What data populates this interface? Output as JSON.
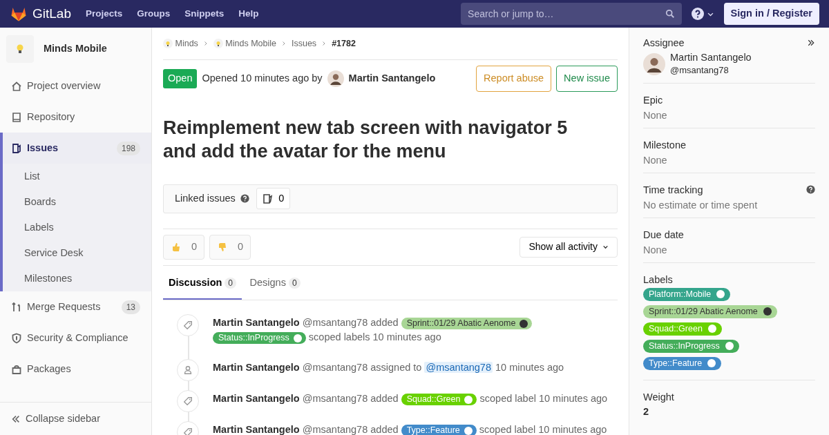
{
  "navbar": {
    "brand": "GitLab",
    "links": [
      "Projects",
      "Groups",
      "Snippets",
      "Help"
    ],
    "search": {
      "placeholder": "Search or jump to…"
    },
    "sign_in": "Sign in / Register"
  },
  "sidebar": {
    "project": "Minds Mobile",
    "items": [
      {
        "kind": "overview",
        "label": "Project overview",
        "selected": false
      },
      {
        "kind": "repository",
        "label": "Repository",
        "selected": false
      },
      {
        "kind": "issues",
        "label": "Issues",
        "count": "198",
        "selected": true,
        "children": [
          {
            "label": "List",
            "selected": false
          },
          {
            "label": "Boards",
            "selected": false
          },
          {
            "label": "Labels",
            "selected": false
          },
          {
            "label": "Service Desk",
            "selected": false
          },
          {
            "label": "Milestones",
            "selected": false
          }
        ]
      },
      {
        "kind": "merges",
        "label": "Merge Requests",
        "count": "13",
        "selected": false
      },
      {
        "kind": "security",
        "label": "Security & Compliance",
        "selected": false
      },
      {
        "kind": "packages",
        "label": "Packages",
        "selected": false
      }
    ],
    "collapse": "Collapse sidebar"
  },
  "breadcrumbs": [
    {
      "label": "Minds",
      "logo": true
    },
    {
      "label": "Minds Mobile",
      "logo": true
    },
    {
      "label": "Issues",
      "logo": false
    },
    {
      "label": "#1782",
      "logo": false
    }
  ],
  "issue": {
    "status": "Open",
    "opened": "Opened 10 minutes ago by",
    "author": "Martin Santangelo",
    "actions": [
      {
        "label": "Report abuse",
        "kind": "warning"
      },
      {
        "label": "New issue",
        "kind": "success"
      }
    ],
    "title": "Reimplement new tab screen with navigator 5 and add the avatar for the menu",
    "linked_issues": {
      "label": "Linked issues",
      "count": "0"
    },
    "reactions": [
      {
        "kind": "up",
        "count": "0"
      },
      {
        "kind": "down",
        "count": "0"
      }
    ],
    "activity_filter": "Show all activity",
    "tabs": [
      {
        "label": "Discussion",
        "count": "0",
        "selected": true
      },
      {
        "label": "Designs",
        "count": "0",
        "selected": false
      }
    ],
    "activity": [
      {
        "kind": "labeling",
        "parts": [
          {
            "kind": "author",
            "text": "Martin Santangelo"
          },
          {
            "kind": "text",
            "text": "@msantang78 added"
          },
          {
            "kind": "label",
            "text": "Sprint::01/29 Abatic Aenome",
            "color": "#a8d695"
          },
          {
            "kind": "label",
            "text": "Status::InProgress",
            "color": "#44ad5a"
          },
          {
            "kind": "text",
            "text": "scoped labels 10 minutes ago"
          }
        ]
      },
      {
        "kind": "assignment",
        "parts": [
          {
            "kind": "author",
            "text": "Martin Santangelo"
          },
          {
            "kind": "text",
            "text": "@msantang78 assigned to"
          },
          {
            "kind": "mention",
            "text": "@msantang78"
          },
          {
            "kind": "text",
            "text": "10 minutes ago"
          }
        ]
      },
      {
        "kind": "labeling",
        "parts": [
          {
            "kind": "author",
            "text": "Martin Santangelo"
          },
          {
            "kind": "text",
            "text": "@msantang78 added"
          },
          {
            "kind": "label",
            "text": "Squad::Green",
            "color": "#69d100"
          },
          {
            "kind": "text",
            "text": "scoped label 10 minutes ago"
          }
        ]
      },
      {
        "kind": "labeling",
        "parts": [
          {
            "kind": "author",
            "text": "Martin Santangelo"
          },
          {
            "kind": "text",
            "text": "@msantang78 added"
          },
          {
            "kind": "label",
            "text": "Type::Feature",
            "color": "#428bca"
          },
          {
            "kind": "text",
            "text": "scoped label 10 minutes ago"
          }
        ]
      }
    ]
  },
  "right_sidebar": [
    {
      "kind": "assignee",
      "title": "Assignee",
      "name": "Martin Santangelo",
      "username": "@msantang78"
    },
    {
      "kind": "text",
      "title": "Epic",
      "value": "None"
    },
    {
      "kind": "text",
      "title": "Milestone",
      "value": "None"
    },
    {
      "kind": "text",
      "title": "Time tracking",
      "value": "No estimate or time spent",
      "help": true
    },
    {
      "kind": "text",
      "title": "Due date",
      "value": "None"
    },
    {
      "kind": "labels",
      "title": "Labels",
      "labels": [
        {
          "text": "Platform::Mobile",
          "color": "#34a58c"
        },
        {
          "text": "Sprint::01/29 Abatic Aenome",
          "color": "#a8d695"
        },
        {
          "text": "Squad::Green",
          "color": "#69d100"
        },
        {
          "text": "Status::InProgress",
          "color": "#44ad5a"
        },
        {
          "text": "Type::Feature",
          "color": "#428bca"
        }
      ]
    },
    {
      "kind": "weight",
      "title": "Weight",
      "value": "2"
    }
  ]
}
